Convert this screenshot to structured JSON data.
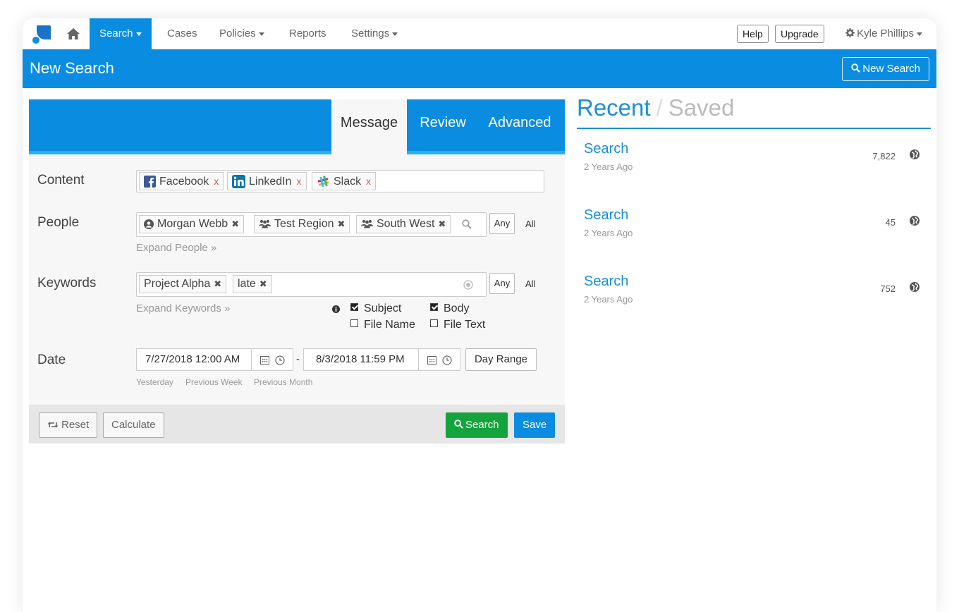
{
  "nav": {
    "items": [
      {
        "label": "Search"
      },
      {
        "label": "Cases"
      },
      {
        "label": "Policies"
      },
      {
        "label": "Reports"
      },
      {
        "label": "Settings"
      }
    ],
    "help": "Help",
    "upgrade": "Upgrade",
    "user": "Kyle Phillips"
  },
  "header": {
    "title": "New Search",
    "new_search_button": "New Search"
  },
  "tabs": [
    "Message",
    "Review",
    "Advanced"
  ],
  "form": {
    "content": {
      "label": "Content",
      "chips": [
        "Facebook",
        "LinkedIn",
        "Slack"
      ],
      "remove_glyph": "x"
    },
    "people": {
      "label": "People",
      "chips": [
        "Morgan Webb",
        "Test Region",
        "South West"
      ],
      "any": "Any",
      "all": "All",
      "expand": "Expand People »"
    },
    "keywords": {
      "label": "Keywords",
      "chips": [
        "Project Alpha",
        "late"
      ],
      "any": "Any",
      "all": "All",
      "expand": "Expand Keywords »",
      "options": [
        {
          "label": "Subject",
          "checked": true
        },
        {
          "label": "Body",
          "checked": true
        },
        {
          "label": "File Name",
          "checked": false
        },
        {
          "label": "File Text",
          "checked": false
        }
      ]
    },
    "date": {
      "label": "Date",
      "from": "7/27/2018 12:00 AM",
      "separator": "-",
      "to": "8/3/2018 11:59 PM",
      "day_range": "Day Range",
      "shortcuts": [
        "Yesterday",
        "Previous Week",
        "Previous Month"
      ]
    }
  },
  "footer": {
    "reset": "Reset",
    "calculate": "Calculate",
    "search": "Search",
    "save": "Save"
  },
  "recent": {
    "heading_recent": "Recent",
    "heading_sep": "/",
    "heading_saved": "Saved",
    "items": [
      {
        "title": "Search",
        "time": "2 Years Ago",
        "count": "7,822"
      },
      {
        "title": "Search",
        "time": "2 Years Ago",
        "count": "45"
      },
      {
        "title": "Search",
        "time": "2 Years Ago",
        "count": "752"
      }
    ]
  },
  "colors": {
    "primary": "#0a8de0",
    "search_green": "#14a33d",
    "link_blue": "#1a8fd6",
    "remove_red": "#d9534f"
  }
}
